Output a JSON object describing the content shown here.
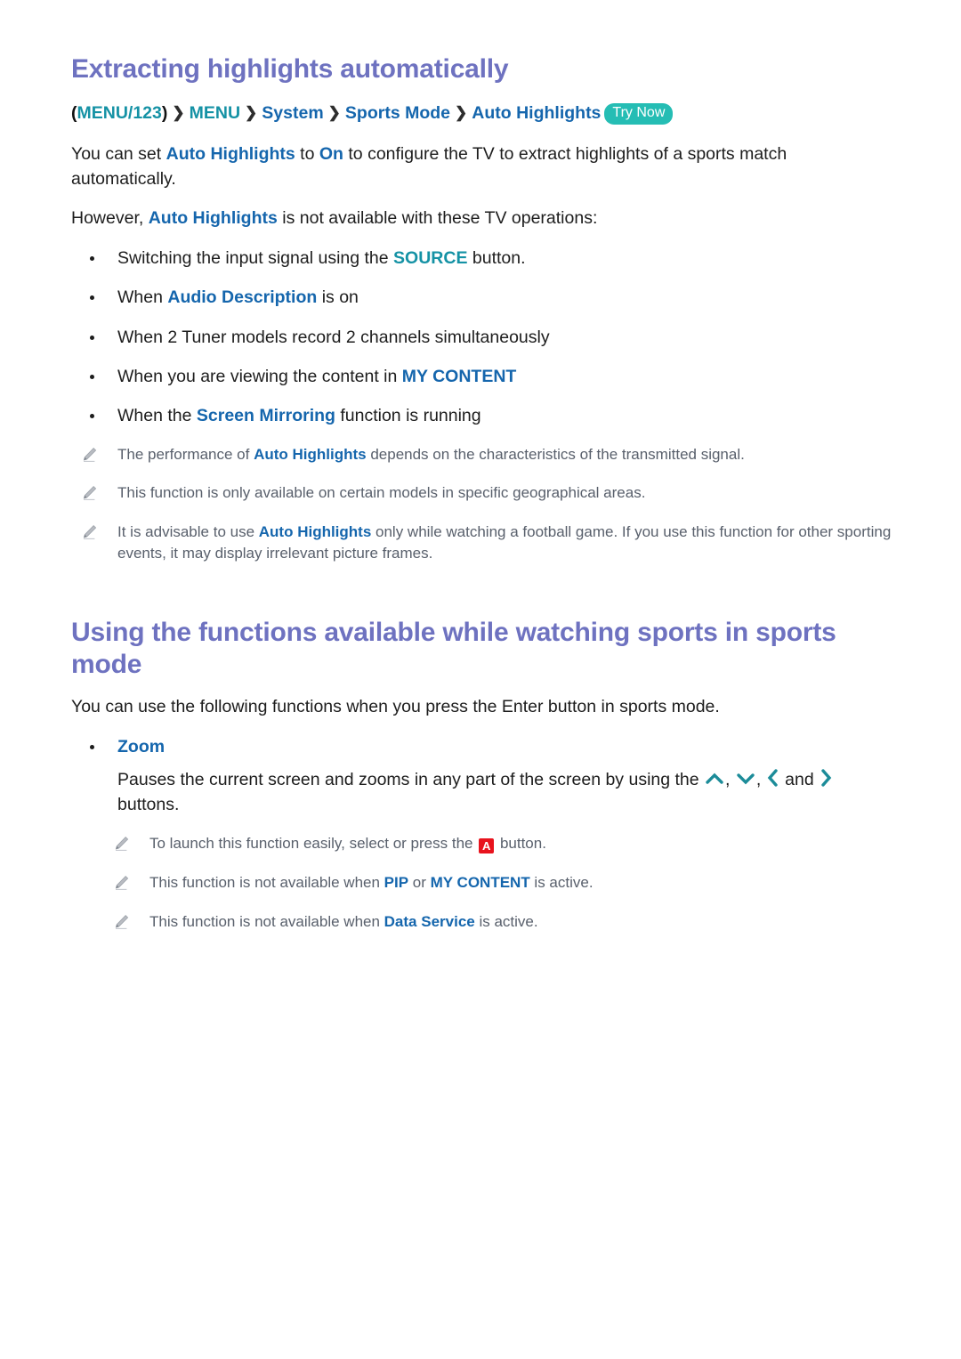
{
  "document": {
    "sections": [
      {
        "id": "extracting-highlights",
        "title": "Extracting highlights automatically",
        "breadcrumb": {
          "open_paren": "(",
          "root": "MENU/123",
          "close_paren": ")",
          "separator": "❯",
          "items": [
            "MENU",
            "System",
            "Sports Mode",
            "Auto Highlights"
          ],
          "badge": "Try Now"
        },
        "paragraphs": [
          {
            "id": "intro",
            "parts": [
              {
                "text": "You can set ",
                "style": "plain"
              },
              {
                "text": "Auto Highlights",
                "style": "blue"
              },
              {
                "text": " to ",
                "style": "plain"
              },
              {
                "text": "On",
                "style": "blue"
              },
              {
                "text": " to configure the TV to extract highlights of a sports match automatically.",
                "style": "plain"
              }
            ]
          },
          {
            "id": "however",
            "parts": [
              {
                "text": "However, ",
                "style": "plain"
              },
              {
                "text": "Auto Highlights",
                "style": "blue"
              },
              {
                "text": " is not available with these TV operations:",
                "style": "plain"
              }
            ]
          }
        ],
        "bullets": [
          {
            "id": "bullet-source",
            "parts": [
              {
                "text": "Switching the input signal using the ",
                "style": "plain"
              },
              {
                "text": "SOURCE",
                "style": "teal"
              },
              {
                "text": " button.",
                "style": "plain"
              }
            ]
          },
          {
            "id": "bullet-audio-description",
            "parts": [
              {
                "text": "When ",
                "style": "plain"
              },
              {
                "text": "Audio Description",
                "style": "blue"
              },
              {
                "text": " is on",
                "style": "plain"
              }
            ]
          },
          {
            "id": "bullet-two-tuner",
            "parts": [
              {
                "text": "When 2 Tuner models record 2 channels simultaneously",
                "style": "plain"
              }
            ]
          },
          {
            "id": "bullet-my-content",
            "parts": [
              {
                "text": "When you are viewing the content in ",
                "style": "plain"
              },
              {
                "text": "MY CONTENT",
                "style": "blue"
              }
            ]
          },
          {
            "id": "bullet-screen-mirroring",
            "parts": [
              {
                "text": "When the ",
                "style": "plain"
              },
              {
                "text": "Screen Mirroring",
                "style": "blue"
              },
              {
                "text": " function is running",
                "style": "plain"
              }
            ]
          }
        ],
        "notes": [
          {
            "id": "note-performance",
            "icon": "pencil-icon",
            "parts": [
              {
                "text": "The performance of ",
                "style": "plain"
              },
              {
                "text": "Auto Highlights",
                "style": "blue"
              },
              {
                "text": " depends on the characteristics of the transmitted signal.",
                "style": "plain"
              }
            ]
          },
          {
            "id": "note-availability",
            "icon": "pencil-icon",
            "parts": [
              {
                "text": "This function is only available on certain models in specific geographical areas.",
                "style": "plain"
              }
            ]
          },
          {
            "id": "note-football",
            "icon": "pencil-icon",
            "parts": [
              {
                "text": "It is advisable to use ",
                "style": "plain"
              },
              {
                "text": "Auto Highlights",
                "style": "blue"
              },
              {
                "text": " only while watching a football game. If you use this function for other sporting events, it may display irrelevant picture frames.",
                "style": "plain"
              }
            ]
          }
        ]
      },
      {
        "id": "using-functions",
        "title": "Using the functions available while watching sports in sports mode",
        "paragraphs": [
          {
            "id": "intro2",
            "parts": [
              {
                "text": "You can use the following functions when you press the Enter button in sports mode.",
                "style": "plain"
              }
            ]
          }
        ],
        "zoom_item": {
          "label": "Zoom",
          "description_before": "Pauses the current screen and zooms in any part of the screen by using the ",
          "glyph_sep_1": ", ",
          "glyph_sep_2": ", ",
          "glyph_and": " and ",
          "description_after": " buttons.",
          "icons": [
            "chevron-up-icon",
            "chevron-down-icon",
            "chevron-left-icon",
            "chevron-right-icon"
          ]
        },
        "notes": [
          {
            "id": "note-launch",
            "icon": "pencil-icon",
            "parts": [
              {
                "text": "To launch this function easily, select or press the ",
                "style": "plain"
              },
              {
                "text": "A",
                "style": "button-a"
              },
              {
                "text": " button.",
                "style": "plain"
              }
            ]
          },
          {
            "id": "note-pip",
            "icon": "pencil-icon",
            "parts": [
              {
                "text": "This function is not available when ",
                "style": "plain"
              },
              {
                "text": "PIP",
                "style": "blue"
              },
              {
                "text": " or ",
                "style": "plain"
              },
              {
                "text": "MY CONTENT",
                "style": "blue"
              },
              {
                "text": " is active.",
                "style": "plain"
              }
            ]
          },
          {
            "id": "note-data-service",
            "icon": "pencil-icon",
            "parts": [
              {
                "text": "This function is not available when ",
                "style": "plain"
              },
              {
                "text": "Data Service",
                "style": "blue"
              },
              {
                "text": " is active.",
                "style": "plain"
              }
            ]
          }
        ]
      }
    ],
    "colors": {
      "heading": "#6e72c0",
      "link_blue": "#1566ad",
      "link_teal": "#1592a5",
      "badge_teal": "#25bdb4",
      "button_red": "#e8131d",
      "note_gray": "#59606c",
      "body": "#1d1d1d"
    }
  }
}
